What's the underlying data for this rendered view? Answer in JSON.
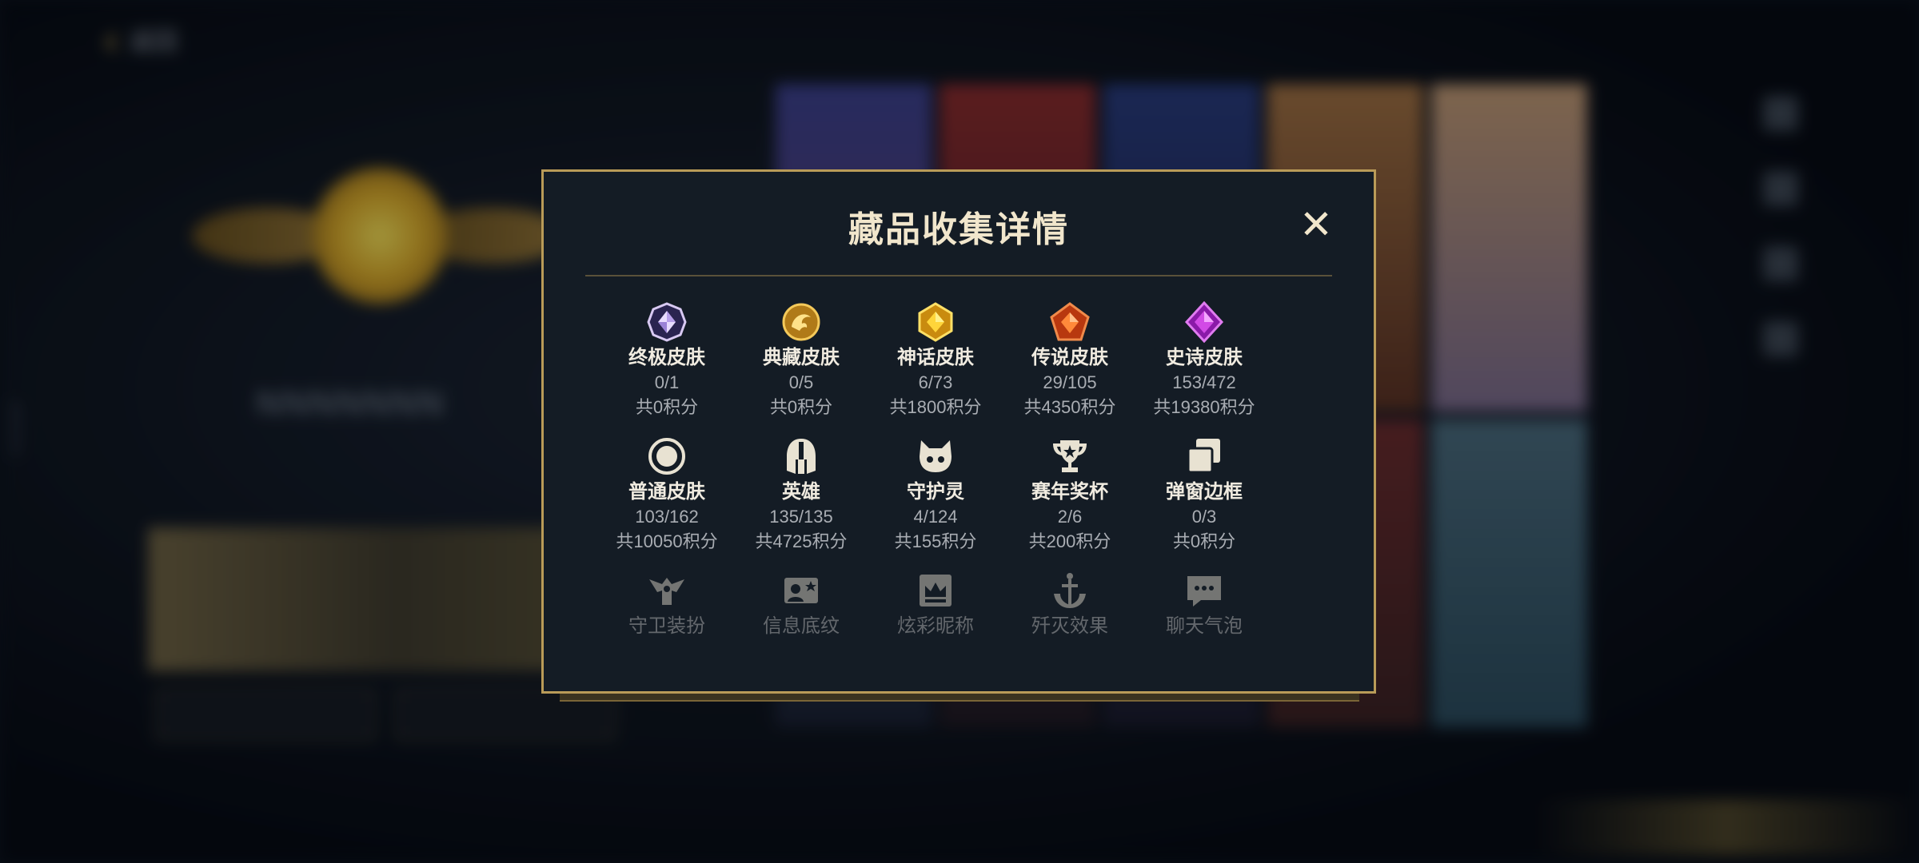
{
  "background": {
    "back_label": "返回",
    "player_name": "NNNNNNN",
    "player_sub": "",
    "banner_btn_1": "",
    "banner_btn_2": "",
    "bottom_tabs": [
      "",
      "",
      "",
      "",
      ""
    ],
    "side_id": "4693254"
  },
  "modal": {
    "title": "藏品收集详情",
    "close_label": "✕",
    "rows": [
      [
        {
          "icon": "ultimate-skin-icon",
          "name": "终极皮肤",
          "count": "0/1",
          "points": "共0积分"
        },
        {
          "icon": "classic-skin-icon",
          "name": "典藏皮肤",
          "count": "0/5",
          "points": "共0积分"
        },
        {
          "icon": "mythic-skin-icon",
          "name": "神话皮肤",
          "count": "6/73",
          "points": "共1800积分"
        },
        {
          "icon": "legendary-skin-icon",
          "name": "传说皮肤",
          "count": "29/105",
          "points": "共4350积分"
        },
        {
          "icon": "epic-skin-icon",
          "name": "史诗皮肤",
          "count": "153/472",
          "points": "共19380积分"
        }
      ],
      [
        {
          "icon": "normal-skin-icon",
          "name": "普通皮肤",
          "count": "103/162",
          "points": "共10050积分"
        },
        {
          "icon": "hero-helmet-icon",
          "name": "英雄",
          "count": "135/135",
          "points": "共4725积分"
        },
        {
          "icon": "guardian-spirit-icon",
          "name": "守护灵",
          "count": "4/124",
          "points": "共155积分"
        },
        {
          "icon": "trophy-icon",
          "name": "赛年奖杯",
          "count": "2/6",
          "points": "共200积分"
        },
        {
          "icon": "popup-frame-icon",
          "name": "弹窗边框",
          "count": "0/3",
          "points": "共0积分"
        }
      ],
      [
        {
          "icon": "guard-outfit-icon",
          "name": "守卫装扮",
          "count": "",
          "points": ""
        },
        {
          "icon": "info-pattern-icon",
          "name": "信息底纹",
          "count": "",
          "points": ""
        },
        {
          "icon": "nickname-crown-icon",
          "name": "炫彩昵称",
          "count": "",
          "points": ""
        },
        {
          "icon": "anchor-icon",
          "name": "歼灭效果",
          "count": "",
          "points": ""
        },
        {
          "icon": "chat-bubble-icon",
          "name": "聊天气泡",
          "count": "",
          "points": ""
        }
      ]
    ]
  },
  "colors": {
    "gold": "#b99b58",
    "panel": "#141c25",
    "title": "#f1e6cc"
  }
}
